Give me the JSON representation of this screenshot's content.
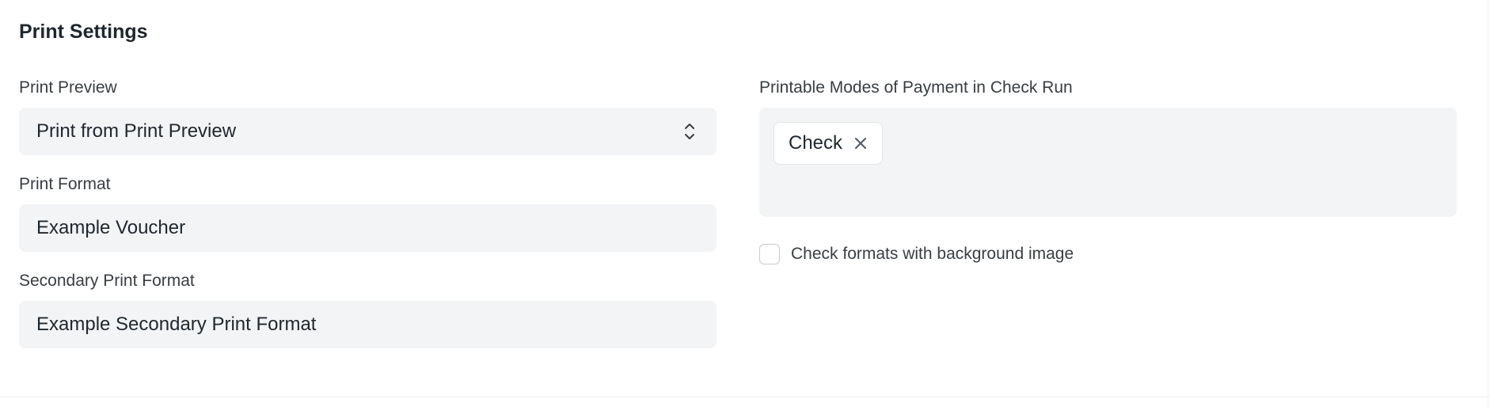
{
  "section": {
    "title": "Print Settings"
  },
  "left_fields": {
    "print_preview": {
      "label": "Print Preview",
      "value": "Print from Print Preview",
      "icon": "select-arrows-icon"
    },
    "print_format": {
      "label": "Print Format",
      "value": "Example Voucher"
    },
    "secondary_print_format": {
      "label": "Secondary Print Format",
      "value": "Example Secondary Print Format"
    }
  },
  "right_fields": {
    "printable_modes": {
      "label": "Printable Modes of Payment in Check Run",
      "pills": [
        {
          "label": "Check",
          "icon": "close-icon"
        }
      ]
    },
    "background_image": {
      "label": "Check formats with background image",
      "checked": false
    }
  },
  "colors": {
    "control_bg": "#f3f4f6",
    "text": "#1f272e",
    "label": "#383e43",
    "border": "#e2e4e7"
  }
}
